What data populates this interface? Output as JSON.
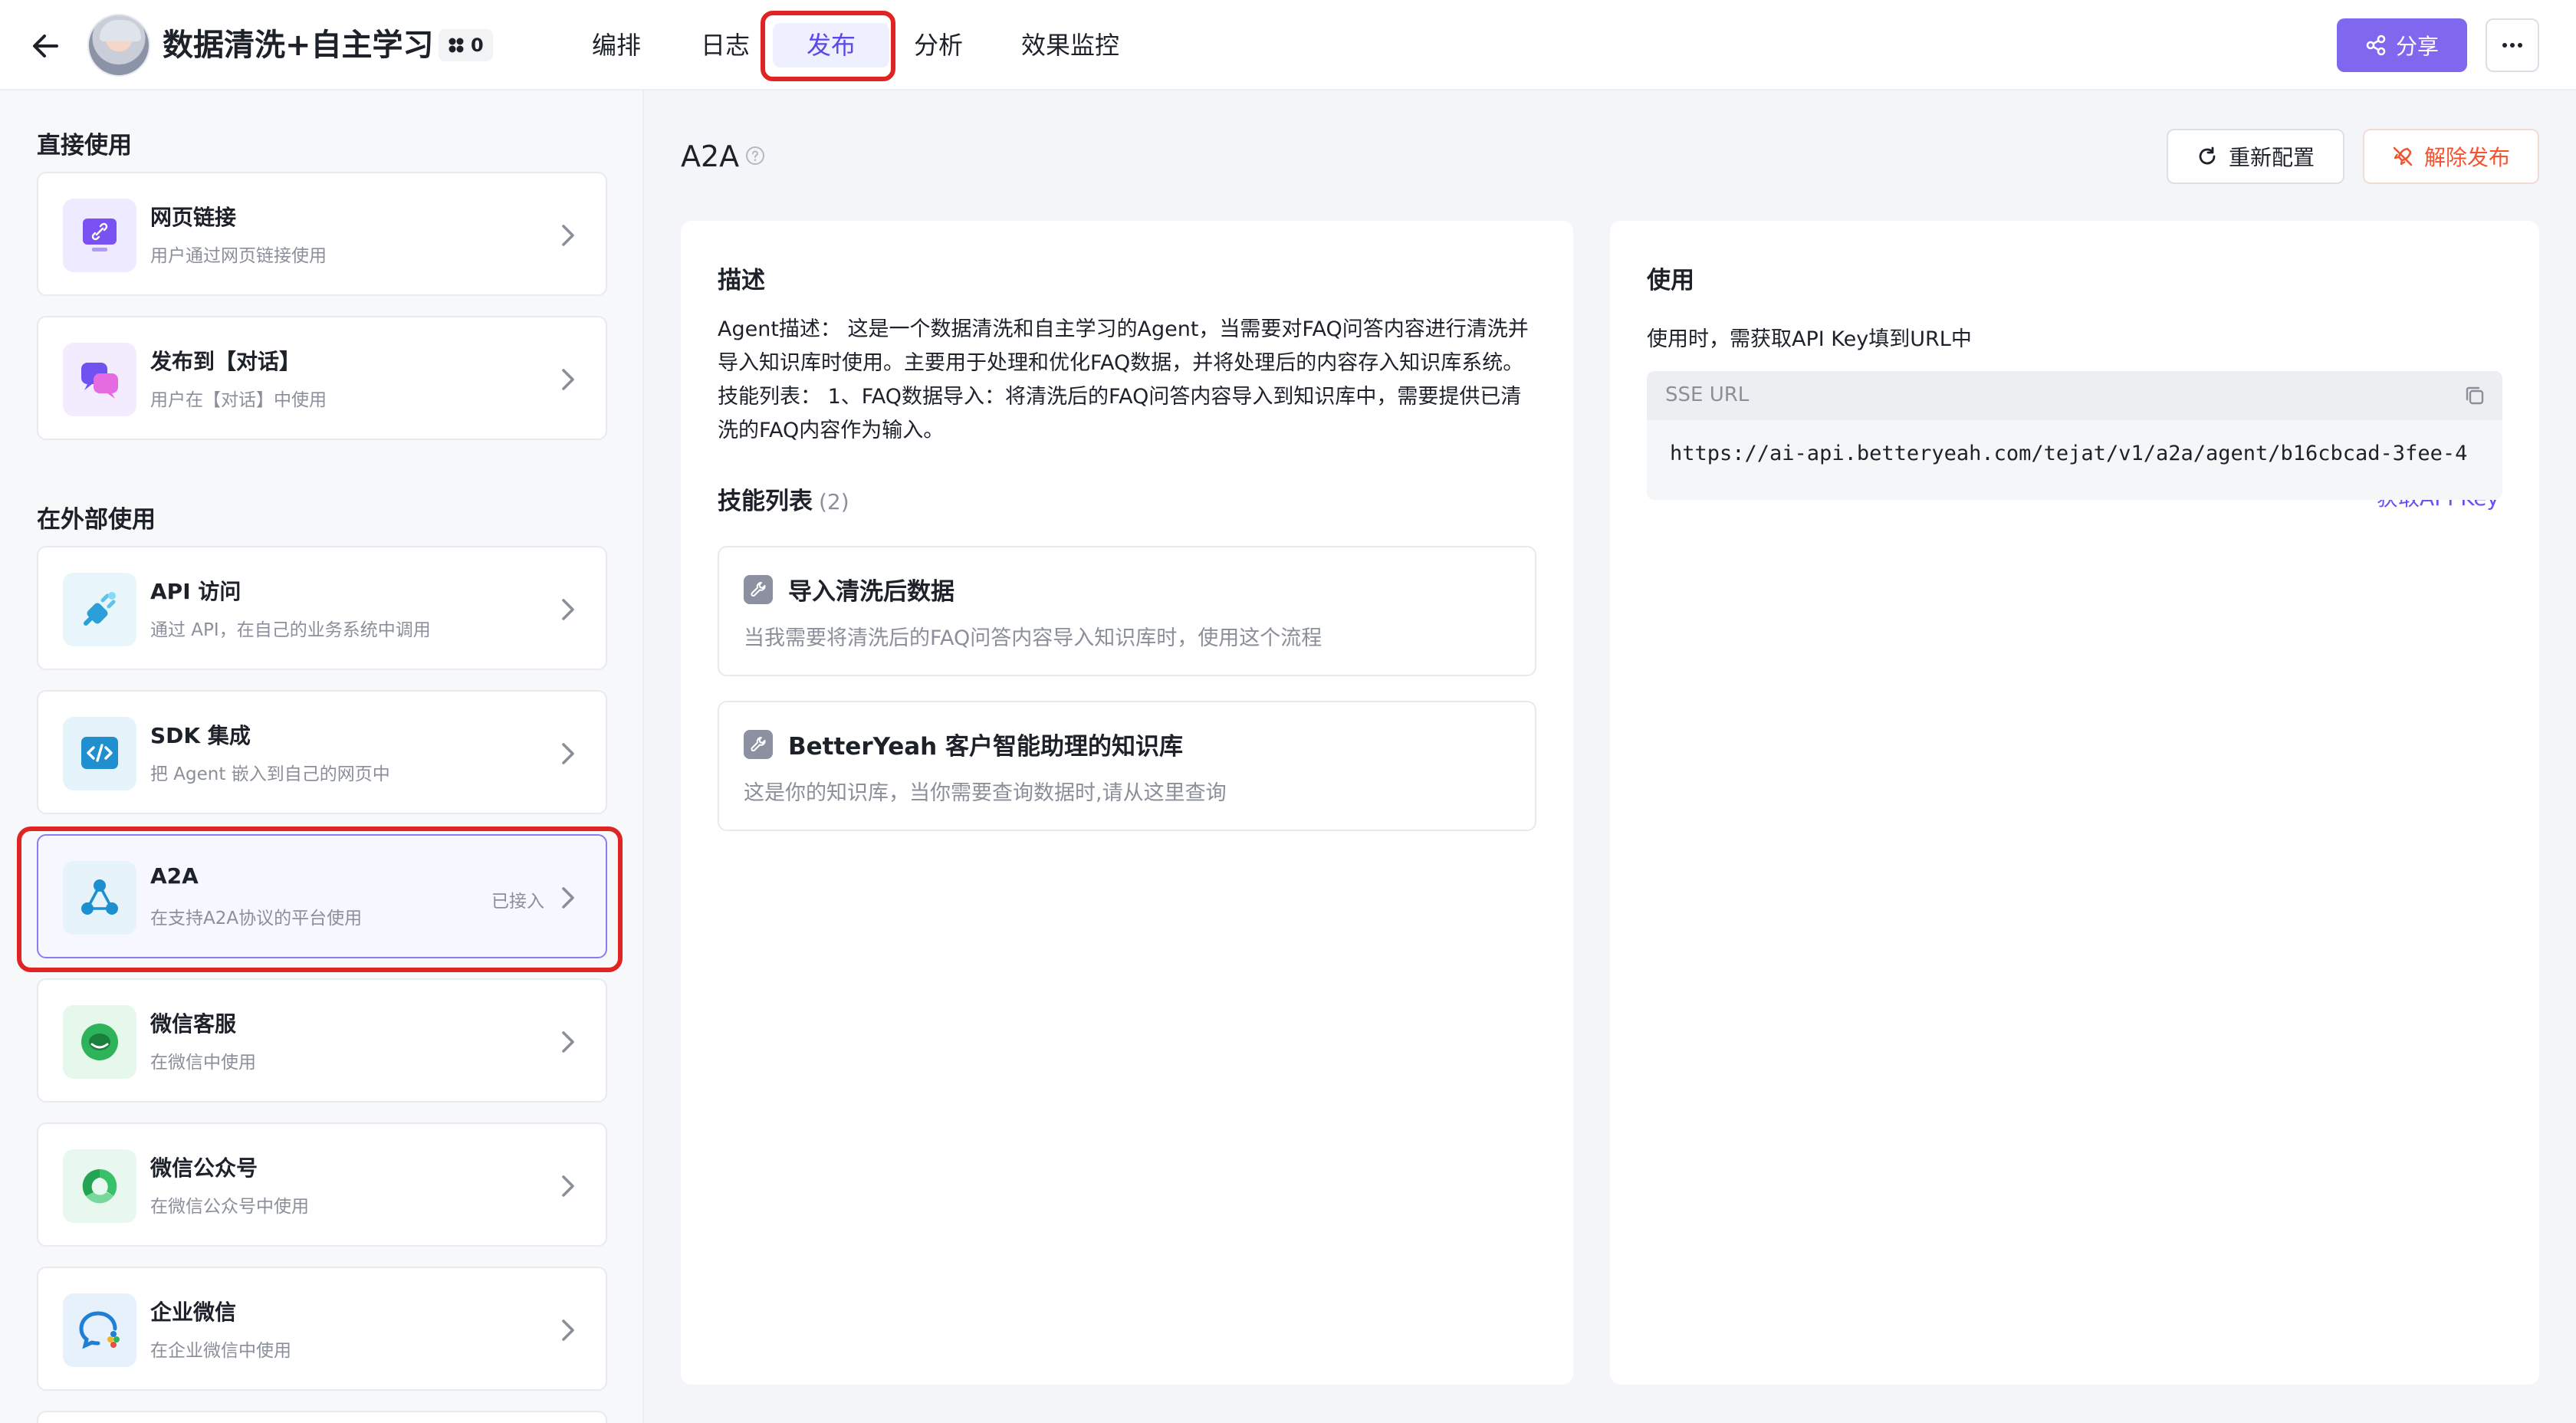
{
  "header": {
    "title": "数据清洗+自主学习",
    "team_count": "0",
    "tabs": [
      {
        "label": "编排"
      },
      {
        "label": "日志"
      },
      {
        "label": "发布"
      },
      {
        "label": "分析"
      },
      {
        "label": "效果监控"
      }
    ],
    "share_label": "分享"
  },
  "sidebar": {
    "direct_title": "直接使用",
    "external_title": "在外部使用",
    "items": [
      {
        "name": "网页链接",
        "desc": "用户通过网页链接使用"
      },
      {
        "name": "发布到【对话】",
        "desc": "用户在【对话】中使用"
      },
      {
        "name": "API 访问",
        "desc": "通过 API，在自己的业务系统中调用"
      },
      {
        "name": "SDK 集成",
        "desc": "把 Agent 嵌入到自己的网页中"
      },
      {
        "name": "A2A",
        "desc": "在支持A2A协议的平台使用",
        "status": "已接入"
      },
      {
        "name": "微信客服",
        "desc": "在微信中使用"
      },
      {
        "name": "微信公众号",
        "desc": "在微信公众号中使用"
      },
      {
        "name": "企业微信",
        "desc": "在企业微信中使用"
      }
    ]
  },
  "main": {
    "title": "A2A",
    "reconfigure_label": "重新配置",
    "unpublish_label": "解除发布",
    "description": {
      "heading": "描述",
      "text": "Agent描述： 这是一个数据清洗和自主学习的Agent，当需要对FAQ问答内容进行清洗并导入知识库时使用。主要用于处理和优化FAQ数据，并将处理后的内容存入知识库系统。 技能列表： 1、FAQ数据导入：将清洗后的FAQ问答内容导入到知识库中，需要提供已清洗的FAQ内容作为输入。"
    },
    "skills": {
      "heading": "技能列表",
      "count": "(2)",
      "items": [
        {
          "name": "导入清洗后数据",
          "desc": "当我需要将清洗后的FAQ问答内容导入知识库时，使用这个流程"
        },
        {
          "name": "BetterYeah 客户智能助理的知识库",
          "desc": "这是你的知识库，当你需要查询数据时,请从这里查询"
        }
      ]
    },
    "usage": {
      "heading": "使用",
      "api_key_link": "获取API Key",
      "instruction": "使用时，需获取API Key填到URL中",
      "url_label": "SSE URL",
      "url_value": "https://ai-api.betteryeah.com/tejat/v1/a2a/agent/b16cbcad-3fee-4"
    }
  },
  "colors": {
    "accent": "#7f67ee",
    "danger": "#f5522d",
    "highlight": "#e02424"
  }
}
